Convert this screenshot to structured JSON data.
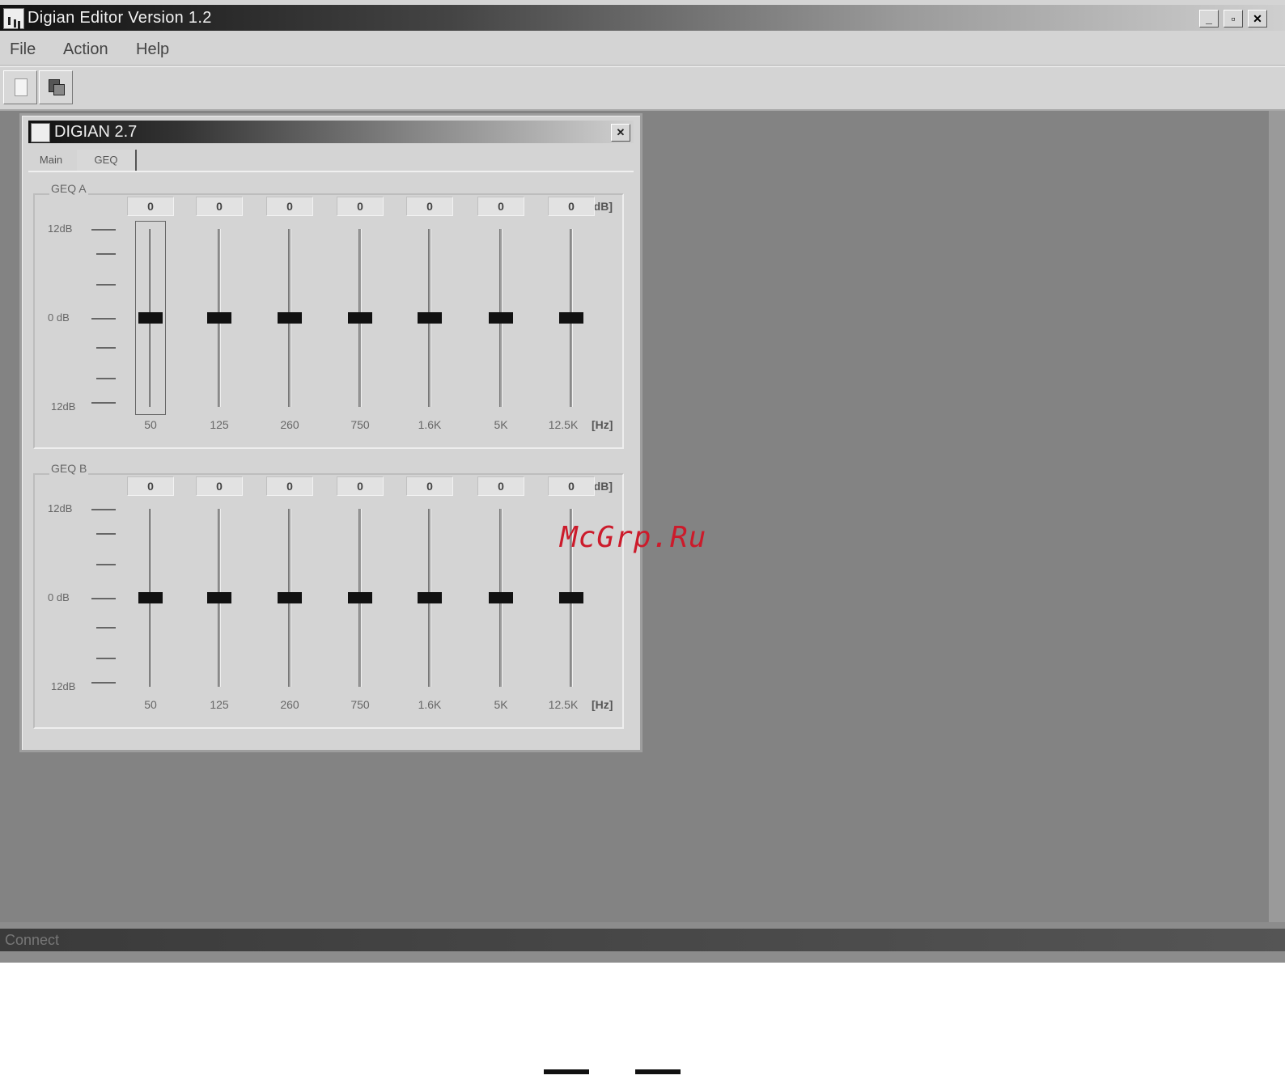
{
  "app": {
    "title": "Digian Editor Version 1.2",
    "window_buttons": {
      "minimize": "_",
      "maximize": "▫",
      "close": "✕"
    }
  },
  "menubar": {
    "items": [
      {
        "label": "File"
      },
      {
        "label": "Action"
      },
      {
        "label": "Help"
      }
    ]
  },
  "toolbar": {
    "buttons": [
      {
        "icon": "new-document-icon"
      },
      {
        "icon": "connect-device-icon"
      }
    ]
  },
  "child_window": {
    "title": "DIGIAN 2.7",
    "close": "✕",
    "tabs": [
      {
        "label": "Main",
        "active": false
      },
      {
        "label": "GEQ",
        "active": true
      }
    ]
  },
  "geq_a": {
    "label": "GEQ A",
    "db_unit": "[dB]",
    "hz_unit": "[Hz]",
    "scale": {
      "top": "12dB",
      "mid": "0 dB",
      "bottom": "12dB"
    },
    "bands": [
      {
        "freq": "50",
        "db": "0",
        "level": 0.5
      },
      {
        "freq": "125",
        "db": "0",
        "level": 0.5
      },
      {
        "freq": "260",
        "db": "0",
        "level": 0.5
      },
      {
        "freq": "750",
        "db": "0",
        "level": 0.5
      },
      {
        "freq": "1.6K",
        "db": "0",
        "level": 0.5
      },
      {
        "freq": "5K",
        "db": "0",
        "level": 0.5
      },
      {
        "freq": "12.5K",
        "db": "0",
        "level": 0.5
      }
    ]
  },
  "geq_b": {
    "label": "GEQ B",
    "db_unit": "[dB]",
    "hz_unit": "[Hz]",
    "scale": {
      "top": "12dB",
      "mid": "0 dB",
      "bottom": "12dB"
    },
    "bands": [
      {
        "freq": "50",
        "db": "0",
        "level": 0.5
      },
      {
        "freq": "125",
        "db": "0",
        "level": 0.5
      },
      {
        "freq": "260",
        "db": "0",
        "level": 0.5
      },
      {
        "freq": "750",
        "db": "0",
        "level": 0.5
      },
      {
        "freq": "1.6K",
        "db": "0",
        "level": 0.5
      },
      {
        "freq": "5K",
        "db": "0",
        "level": 0.5
      },
      {
        "freq": "12.5K",
        "db": "0",
        "level": 0.5
      }
    ]
  },
  "statusbar": {
    "text": "Connect"
  },
  "watermark": {
    "text": "McGrp.Ru",
    "color": "#cc1b2b"
  }
}
